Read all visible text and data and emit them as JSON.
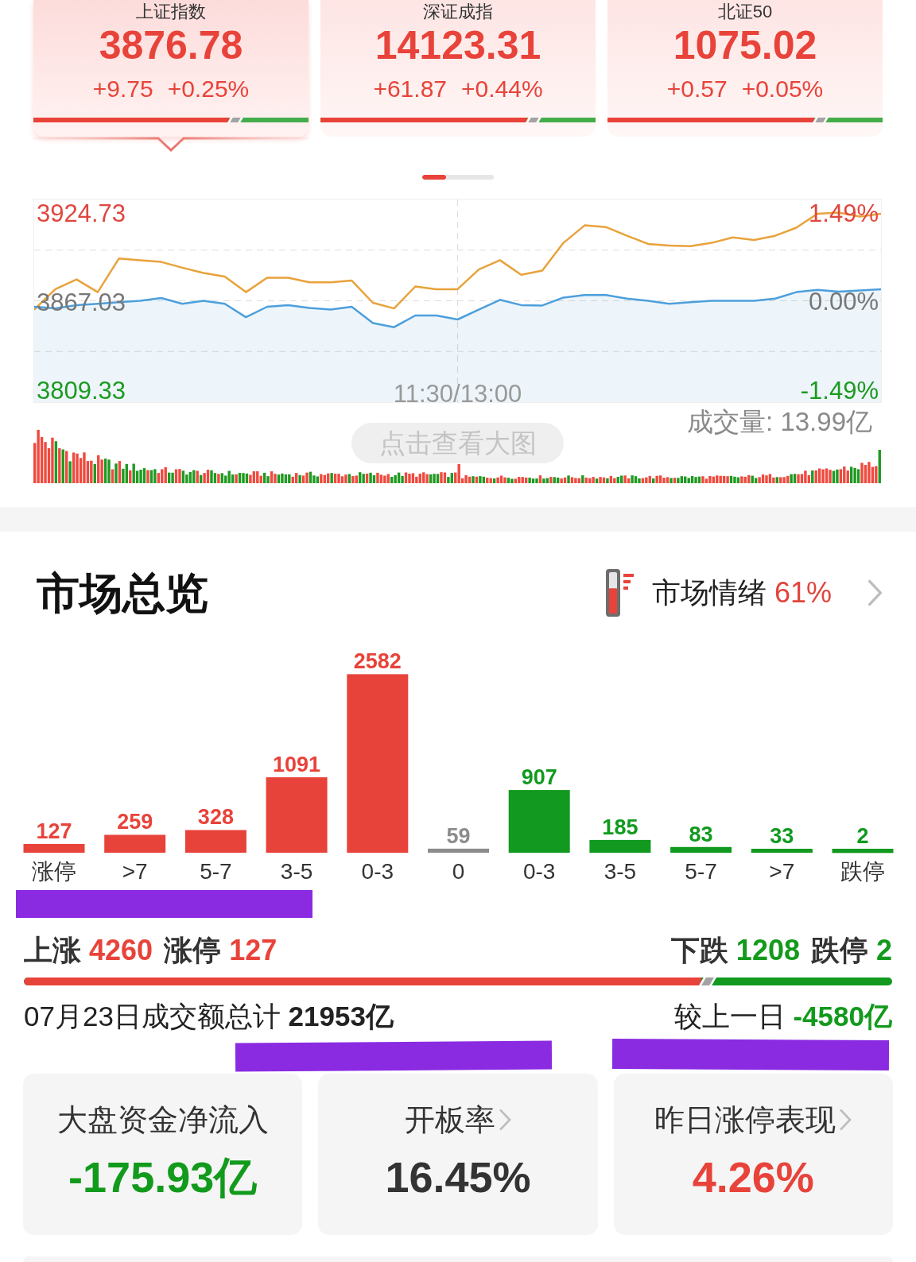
{
  "index_cards": [
    {
      "title": "上证指数",
      "value": "3876.78",
      "change": "+9.75",
      "change_pct": "+0.25%",
      "color": "#e8433a",
      "level": 0.71,
      "selected": true
    },
    {
      "title": "深证成指",
      "value": "14123.31",
      "change": "+61.87",
      "change_pct": "+0.44%",
      "color": "#e8433a",
      "level": 0.75,
      "selected": false
    },
    {
      "title": "北证50",
      "value": "1075.02",
      "change": "+0.57",
      "change_pct": "+0.05%",
      "color": "#e8433a",
      "level": 0.75,
      "selected": false
    }
  ],
  "pager": [
    {
      "selected": true
    },
    {
      "selected": false
    },
    {
      "selected": false
    }
  ],
  "intraday": {
    "chart_data": {
      "type": "line",
      "ylim": [
        3802.09,
        3934.05
      ],
      "yticks": [
        {
          "value": 3924.73,
          "label": "3924.73"
        },
        {
          "value": 3867.03,
          "label": "3867.03"
        },
        {
          "value": 3809.33,
          "label": "3809.33"
        }
      ],
      "y2lim": [
        -1.68,
        1.73
      ],
      "y2ticks": [
        {
          "value": 1.49,
          "label": "1.49%"
        },
        {
          "value": 0,
          "label": "0.00%"
        },
        {
          "value": -1.49,
          "label": "-1.49%"
        }
      ],
      "annotations": [
        "11:30/13:00"
      ],
      "series": [
        {
          "color": "#e9a23b",
          "values": [
            3862.3,
            3875.6,
            3882.0,
            3873.7,
            3895.6,
            3894.5,
            3893.4,
            3889.6,
            3886.2,
            3883.9,
            3873.7,
            3883.1,
            3883.1,
            3880.1,
            3880.1,
            3881.2,
            3866.8,
            3863.1,
            3877.4,
            3875.6,
            3875.6,
            3888.4,
            3894.5,
            3885.0,
            3887.7,
            3905.8,
            3917.2,
            3916.1,
            3910.4,
            3905.1,
            3904.0,
            3903.6,
            3905.8,
            3909.3,
            3907.7,
            3910.4,
            3915.7,
            3924.8,
            3925.5,
            3922.9,
            3924.8
          ]
        },
        {
          "color": "#4d9fdc",
          "type": "area",
          "values": [
            3864.2,
            3863.1,
            3865.3,
            3866.1,
            3867.2,
            3868.0,
            3869.9,
            3866.1,
            3868.0,
            3866.1,
            3857.4,
            3864.2,
            3865.3,
            3863.4,
            3862.3,
            3864.2,
            3853.6,
            3850.9,
            3858.5,
            3858.5,
            3855.9,
            3862.3,
            3868.7,
            3865.3,
            3865.0,
            3870.2,
            3871.8,
            3871.8,
            3869.5,
            3868.0,
            3866.1,
            3867.2,
            3868.0,
            3868.0,
            3868.0,
            3869.5,
            3873.7,
            3875.2,
            3874.0,
            3874.8,
            3875.6
          ]
        }
      ]
    },
    "volume_label": "成交量: 13.99亿",
    "enlarge_button": "点击查看大图"
  },
  "market_overview": {
    "title": "市场总览",
    "sentiment": {
      "label": "市场情绪",
      "value": "61%",
      "level": 0.61
    },
    "distribution": {
      "chart_data": {
        "type": "bar",
        "categories": [
          "涨停",
          ">7",
          "5-7",
          "3-5",
          "0-3",
          "0",
          "0-3",
          "3-5",
          "5-7",
          ">7",
          "跌停"
        ],
        "series": [
          {
            "color": "#e8433a",
            "values": [
              127,
              259,
              328,
              1091,
              2582,
              null,
              null,
              null,
              null,
              null,
              null
            ]
          },
          {
            "color": "#8c8c8c",
            "values": [
              null,
              null,
              null,
              null,
              null,
              59,
              null,
              null,
              null,
              null,
              null
            ]
          },
          {
            "color": "#119a1f",
            "values": [
              null,
              null,
              null,
              null,
              null,
              null,
              907,
              185,
              83,
              33,
              2
            ]
          }
        ],
        "stacked": true,
        "data_labels": true
      }
    },
    "breadth": {
      "advances": [
        {
          "label": "上涨",
          "value": "4260",
          "color": "#e8433a"
        },
        {
          "label": "涨停",
          "value": "127",
          "color": "#e8433a"
        }
      ],
      "declines": [
        {
          "label": "下跌",
          "value": "1208",
          "color": "#129a1c"
        },
        {
          "label": "跌停",
          "value": "2",
          "color": "#129a1c"
        }
      ],
      "level": 0.78
    },
    "turnover": [
      {
        "label": "07月23日成交额总计",
        "amount": "21953亿",
        "color": "#222222"
      },
      {
        "label": "较上一日",
        "amount": "-4580亿",
        "color": "#129a1c"
      }
    ],
    "stat_cards": [
      {
        "title": "大盘资金净流入",
        "value": "-175.93亿",
        "color": "#129a1c",
        "has_link": false
      },
      {
        "title": "开板率",
        "value": "16.45%",
        "color": "#333333",
        "has_link": true
      },
      {
        "title": "昨日涨停表现",
        "value": "4.26%",
        "color": "#e8433a",
        "has_link": true
      }
    ]
  },
  "annotations": [
    {
      "kind": "highlight"
    },
    {
      "kind": "highlight"
    },
    {
      "kind": "highlight"
    }
  ]
}
